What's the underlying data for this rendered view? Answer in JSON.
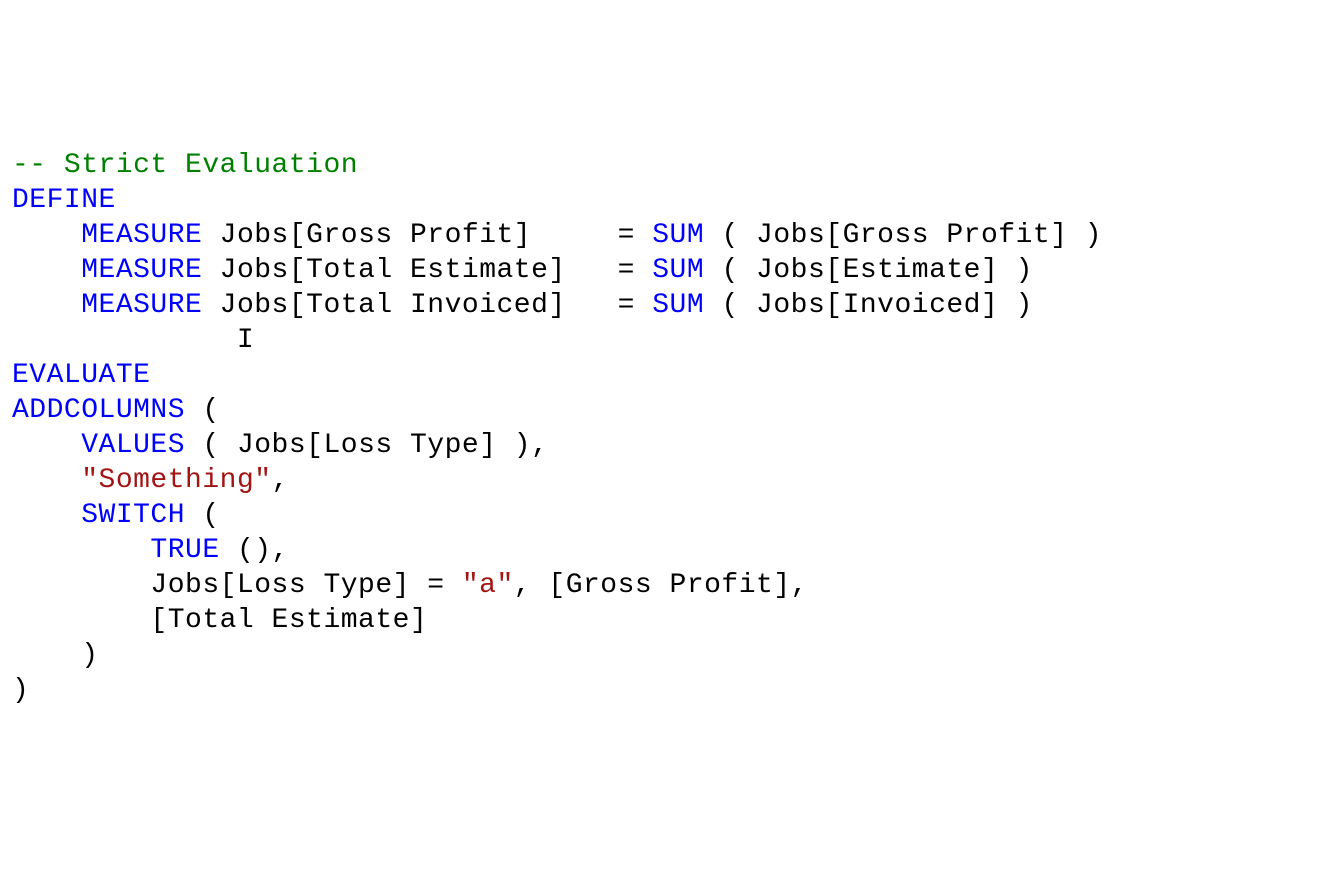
{
  "line1": {
    "comment": "-- Strict Evaluation"
  },
  "line2": {
    "define": "DEFINE"
  },
  "line3": {
    "measure": "    MEASURE",
    "decl": " Jobs[Gross Profit]     = ",
    "sum": "SUM",
    "args": " ( Jobs[Gross Profit] )"
  },
  "line4": {
    "measure": "    MEASURE",
    "decl": " Jobs[Total Estimate]   = ",
    "sum": "SUM",
    "args": " ( Jobs[Estimate] )"
  },
  "line5": {
    "measure": "    MEASURE",
    "decl": " Jobs[Total Invoiced]   = ",
    "sum": "SUM",
    "args": " ( Jobs[Invoiced] )"
  },
  "line7": {
    "evaluate": "EVALUATE"
  },
  "line8": {
    "addcolumns": "ADDCOLUMNS",
    "paren": " ("
  },
  "line9": {
    "indent": "    ",
    "values": "VALUES",
    "args": " ( Jobs[Loss Type] ),"
  },
  "line10": {
    "indent": "    ",
    "string": "\"Something\"",
    "comma": ","
  },
  "line11": {
    "indent": "    ",
    "switch": "SWITCH",
    "paren": " ("
  },
  "line12": {
    "indent": "        ",
    "true": "TRUE",
    "rest": " (),"
  },
  "line13": {
    "indent": "        Jobs[Loss Type] = ",
    "string": "\"a\"",
    "rest": ", [Gross Profit],"
  },
  "line14": {
    "text": "        [Total Estimate]"
  },
  "line15": {
    "text": "    )"
  },
  "line16": {
    "text": ")"
  }
}
